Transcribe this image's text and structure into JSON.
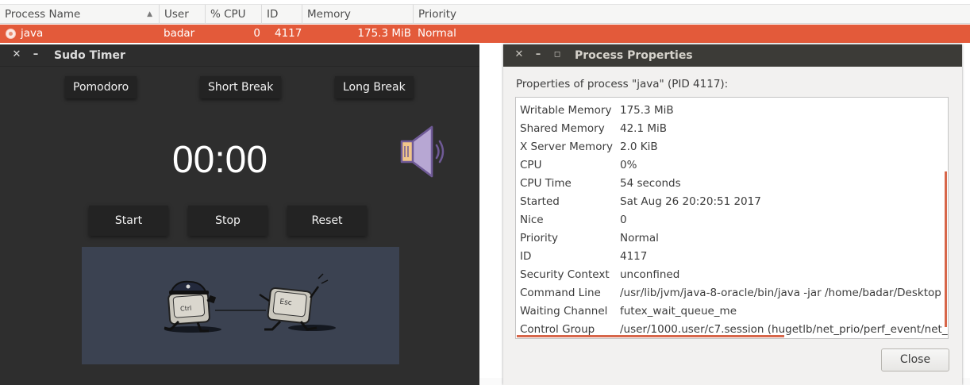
{
  "process_monitor": {
    "columns": [
      "Process Name",
      "User",
      "% CPU",
      "ID",
      "Memory",
      "Priority"
    ],
    "selected_row": {
      "name": "java",
      "user": "badar",
      "cpu": "0",
      "id": "4117",
      "memory": "175.3 MiB",
      "priority": "Normal"
    },
    "accent_color": "#e35a3a"
  },
  "timer_window": {
    "title": "Sudo Timer",
    "modes": [
      "Pomodoro",
      "Short Break",
      "Long Break"
    ],
    "clock": "00:00",
    "buttons": [
      "Start",
      "Stop",
      "Reset"
    ],
    "speaker_icon": "speaker-volume-icon",
    "keycaps": [
      "Ctrl",
      "Esc"
    ]
  },
  "properties_dialog": {
    "title": "Process Properties",
    "heading": "Properties of process \"java\" (PID 4117):",
    "rows": [
      {
        "name": "Writable Memory",
        "value": "175.3 MiB"
      },
      {
        "name": "Shared Memory",
        "value": "42.1 MiB"
      },
      {
        "name": "X Server Memory",
        "value": "2.0 KiB"
      },
      {
        "name": "CPU",
        "value": "0%"
      },
      {
        "name": "CPU Time",
        "value": "54 seconds"
      },
      {
        "name": "Started",
        "value": "Sat Aug 26 20:20:51 2017"
      },
      {
        "name": "Nice",
        "value": "0"
      },
      {
        "name": "Priority",
        "value": "Normal"
      },
      {
        "name": "ID",
        "value": "4117"
      },
      {
        "name": "Security Context",
        "value": "unconfined"
      },
      {
        "name": "Command Line",
        "value": "/usr/lib/jvm/java-8-oracle/bin/java -jar /home/badar/Desktop"
      },
      {
        "name": "Waiting Channel",
        "value": "futex_wait_queue_me"
      },
      {
        "name": "Control Group",
        "value": "/user/1000.user/c7.session (hugetlb/net_prio/perf_event/net_"
      }
    ],
    "close_label": "Close"
  }
}
